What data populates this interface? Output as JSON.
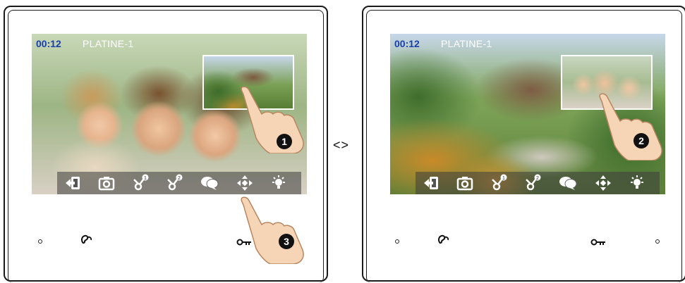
{
  "left_monitor": {
    "time": "00:12",
    "channel": "PLATINE-1",
    "steps": [
      "1",
      "3"
    ]
  },
  "right_monitor": {
    "time": "00:12",
    "channel": "PLATINE-1",
    "steps": [
      "2"
    ]
  },
  "toolbar": {
    "items": [
      "exit-icon",
      "camera-icon",
      "unlock-1-icon",
      "unlock-2-icon",
      "chat-icon",
      "move-icon",
      "light-icon"
    ],
    "lock_badges": [
      "1",
      "2"
    ]
  },
  "separator": "<>",
  "colors": {
    "time": "#1a3fa8",
    "toolbar": "rgba(60,60,60,0.55)",
    "step_badge": "#111111"
  }
}
